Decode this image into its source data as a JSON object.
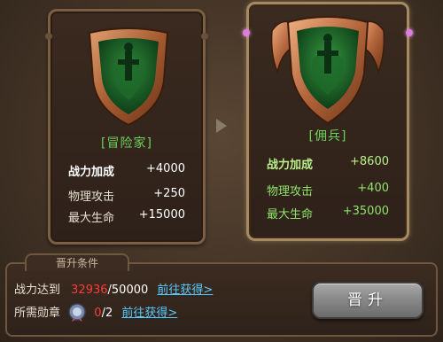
{
  "current": {
    "title": "[冒险家]",
    "stats": [
      {
        "label": "战力加成",
        "value": "+4000"
      },
      {
        "label": "物理攻击",
        "value": "+250"
      },
      {
        "label": "最大生命",
        "value": "+15000"
      }
    ]
  },
  "next": {
    "title": "[佣兵]",
    "stats": [
      {
        "label": "战力加成",
        "value": "+8600"
      },
      {
        "label": "物理攻击",
        "value": "+400"
      },
      {
        "label": "最大生命",
        "value": "+35000"
      }
    ]
  },
  "requirements": {
    "tab_label": "晋升条件",
    "power": {
      "label": "战力达到",
      "current": "32936",
      "target": "/50000",
      "link": "前往获得>"
    },
    "medal": {
      "label": "所需勋章",
      "current": "0",
      "target": "/2",
      "link": "前往获得>",
      "icon": "medal-icon"
    }
  },
  "promote_button": "晋升",
  "colors": {
    "green": "#6ed35a",
    "red": "#ff3a3a",
    "link": "#57c9ff"
  }
}
